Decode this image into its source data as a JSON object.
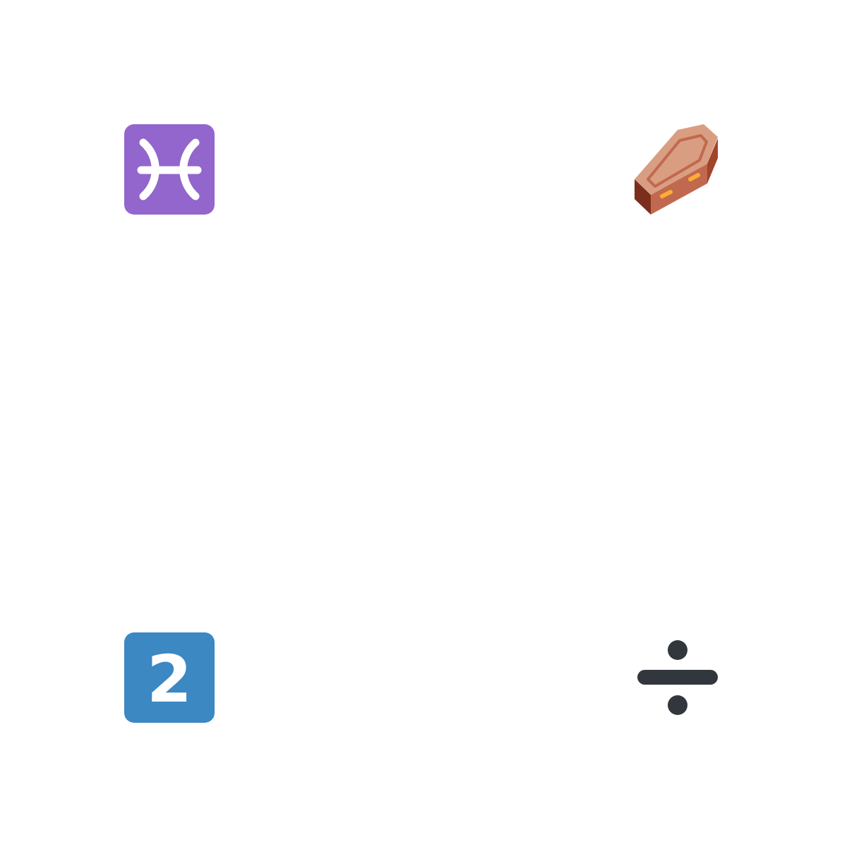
{
  "emojis": [
    {
      "name": "pisces-icon",
      "color": "#9266CC"
    },
    {
      "name": "coffin-icon",
      "color": "#C1694F"
    },
    {
      "name": "keycap-two-icon",
      "color": "#3B88C3",
      "label": "2"
    },
    {
      "name": "division-sign-icon",
      "color": "#31373D"
    }
  ]
}
